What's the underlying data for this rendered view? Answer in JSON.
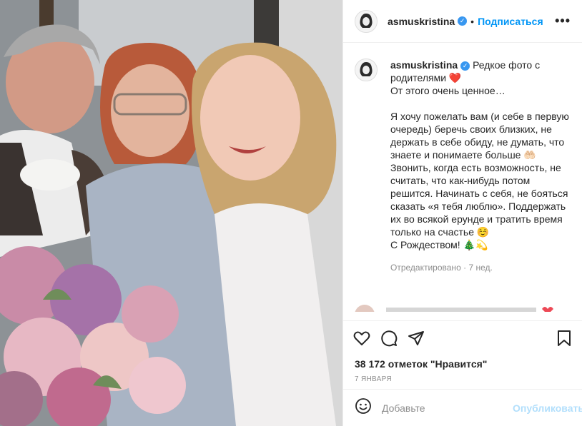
{
  "post": {
    "username": "asmuskristina",
    "follow_label": "Подписаться",
    "separator": "•",
    "more_label": "•••",
    "caption_text": "Редкое фото с родителями ❤️\nОт этого очень ценное…\n\nЯ хочу пожелать вам (и себе в первую очередь) беречь своих близких, не держать в себе обиду, не думать, что знаете и понимаете больше 🤲🏻 Звонить, когда есть возможность, не считать, что как-нибудь потом решится. Начинать с себя, не бояться сказать «я тебя люблю». Поддержать их во всякой ерунде и тратить время только на счастье ☺️\nС Рождеством! 🎄💫",
    "edited_label": "Отредактировано",
    "edited_time": "7 нед.",
    "meta_dot": "·",
    "likes": "38 172 отметок \"Нравится\"",
    "date": "7 ЯНВАРЯ"
  },
  "comment_box": {
    "placeholder": "Добавьте",
    "publish_label": "Опубликовать"
  },
  "icons": [
    "heart-icon",
    "comment-icon",
    "share-icon",
    "bookmark-icon",
    "emoji-icon",
    "verified-badge-icon"
  ],
  "colors": {
    "accent": "#0095f6",
    "publish_disabled": "#b2dffc",
    "verified": "#3897f0",
    "muted": "#8e8e8e"
  }
}
